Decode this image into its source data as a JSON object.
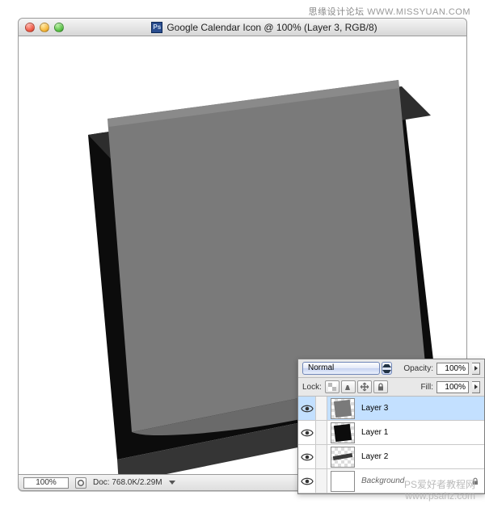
{
  "watermarks": {
    "top_cn": "思缘设计论坛",
    "top_url": "WWW.MISSYUAN.COM",
    "bottom_cn": "PS爱好者教程网",
    "bottom_url": "www.psahz.com"
  },
  "window": {
    "title": "Google Calendar Icon @ 100% (Layer 3, RGB/8)"
  },
  "statusbar": {
    "zoom": "100%",
    "doc": "Doc: 768.0K/2.29M"
  },
  "layers_panel": {
    "blend_mode": "Normal",
    "opacity_label": "Opacity:",
    "opacity_value": "100%",
    "lock_label": "Lock:",
    "fill_label": "Fill:",
    "fill_value": "100%",
    "layers": [
      {
        "name": "Layer 3",
        "selected": true,
        "thumb": "gray-quad"
      },
      {
        "name": "Layer 1",
        "selected": false,
        "thumb": "black-quad"
      },
      {
        "name": "Layer 2",
        "selected": false,
        "thumb": "sliver"
      },
      {
        "name": "Background",
        "selected": false,
        "thumb": "white",
        "locked": true,
        "italic": true
      }
    ]
  }
}
